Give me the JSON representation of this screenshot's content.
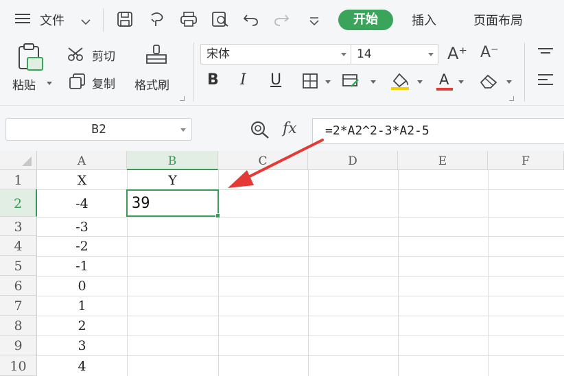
{
  "menubar": {
    "file_label": "文件",
    "tabs": [
      {
        "label": "开始"
      },
      {
        "label": "插入"
      },
      {
        "label": "页面布局"
      }
    ]
  },
  "ribbon": {
    "paste_label": "粘贴",
    "cut_label": "剪切",
    "copy_label": "复制",
    "format_painter_label": "格式刷",
    "font_name": "宋体",
    "font_size": "14",
    "grow_font_label": "A⁺",
    "shrink_font_label": "A⁻",
    "bold_label": "B",
    "italic_label": "I",
    "underline_label": "U",
    "font_color_label": "A"
  },
  "formula_bar": {
    "name_box": "B2",
    "fx_label": "fx",
    "formula": "=2*A2^2-3*A2-5"
  },
  "colors": {
    "accent_green": "#3aa55a",
    "arrow_red": "#e53935"
  },
  "sheet": {
    "columns": [
      "A",
      "B",
      "C",
      "D",
      "E",
      "F"
    ],
    "rows": [
      "1",
      "2",
      "3",
      "4",
      "5",
      "6",
      "7",
      "8",
      "9",
      "10"
    ],
    "col_a": [
      "X",
      "-4",
      "-3",
      "-2",
      "-1",
      "0",
      "1",
      "2",
      "3",
      "4"
    ],
    "b1": "Y",
    "b2": "39"
  }
}
